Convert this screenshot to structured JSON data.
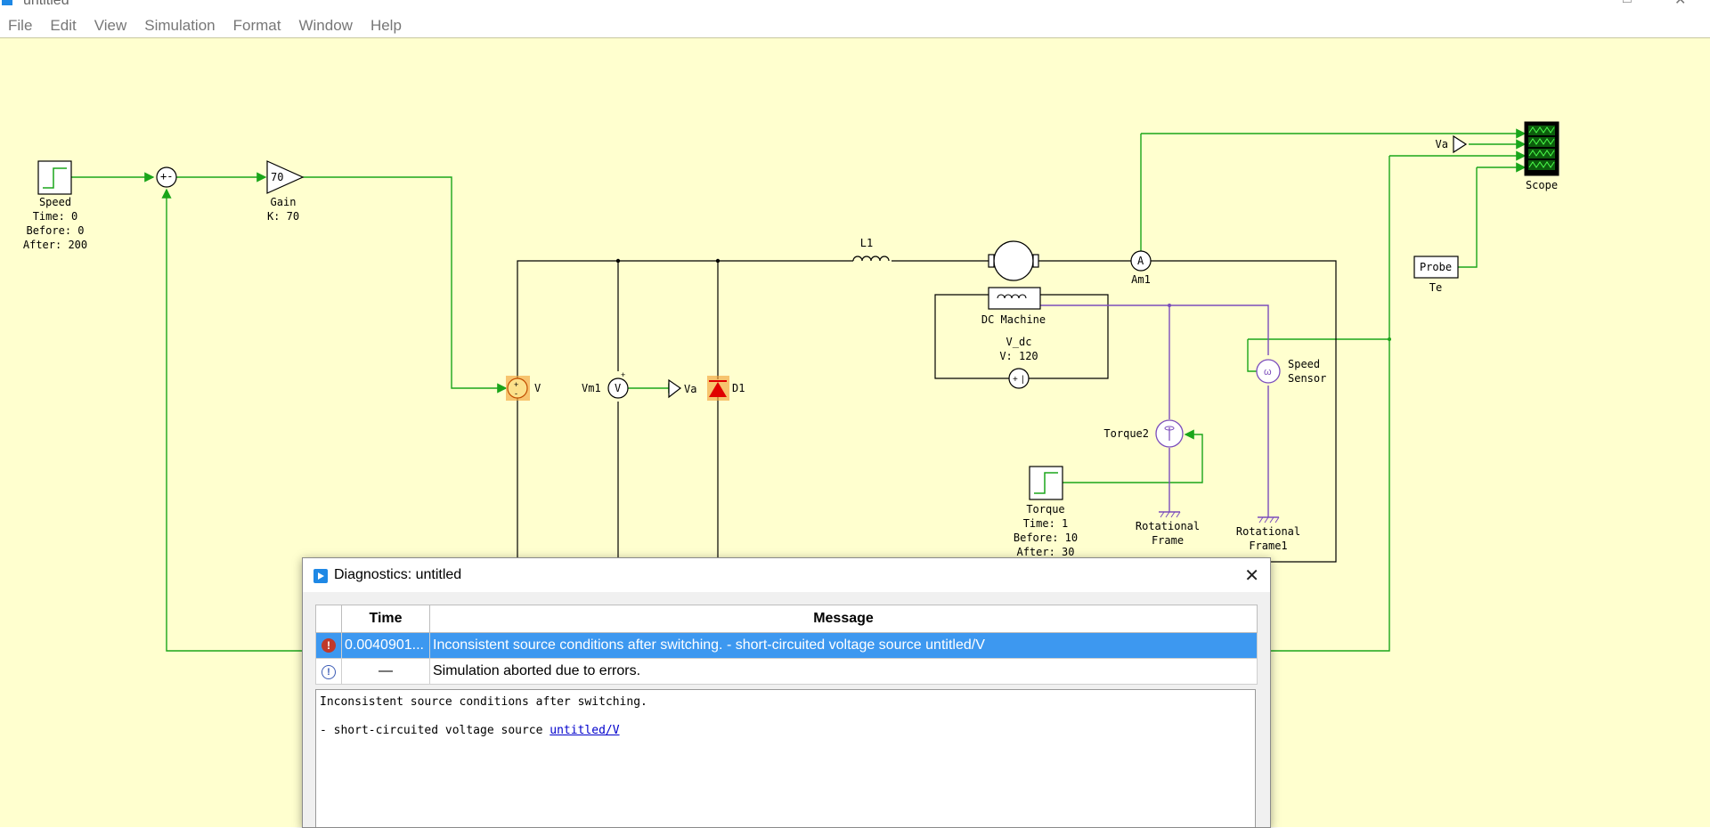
{
  "window": {
    "title": "untitled *"
  },
  "menubar": {
    "items": [
      "File",
      "Edit",
      "View",
      "Simulation",
      "Format",
      "Window",
      "Help"
    ]
  },
  "schematic": {
    "speed_step": {
      "name": "Speed",
      "params": [
        "Time: 0",
        "Before: 0",
        "After: 200"
      ]
    },
    "sum_sign": "+-",
    "gain": {
      "value": "70",
      "name": "Gain",
      "param": "K: 70"
    },
    "voltage_source": "V",
    "voltmeter": {
      "name": "Vm1",
      "symbol": "V"
    },
    "goto_va": "Va",
    "diode": "D1",
    "inductor": "L1",
    "dc_machine": "DC Machine",
    "vdc": {
      "name": "V_dc",
      "param": "V: 120"
    },
    "ammeter": {
      "name": "Am1",
      "symbol": "A"
    },
    "torque_source": "Torque2",
    "torque_step": {
      "name": "Torque",
      "params": [
        "Time: 1",
        "Before: 10",
        "After: 30"
      ]
    },
    "rot_frame": [
      "Rotational",
      "Frame"
    ],
    "rot_frame1": [
      "Rotational",
      "Frame1"
    ],
    "speed_sensor": [
      "Speed",
      "Sensor"
    ],
    "probe": {
      "label": "Probe",
      "name": "Te"
    },
    "scope": "Scope",
    "from_va": "Va"
  },
  "diagnostics": {
    "title": "Diagnostics: untitled",
    "columns": {
      "time": "Time",
      "message": "Message"
    },
    "rows": [
      {
        "type": "error",
        "time": "0.0040901...",
        "message": "Inconsistent source conditions after switching.  - short-circuited voltage source untitled/V"
      },
      {
        "type": "info",
        "time": "—",
        "message": "Simulation aborted due to errors."
      }
    ],
    "detail": {
      "line1": "Inconsistent source conditions after switching.",
      "line2_prefix": "- short-circuited voltage source ",
      "link": "untitled/V"
    }
  },
  "colors": {
    "canvas": "#ffffcf",
    "signal_wire": "#1aa51a",
    "power_wire": "#000000",
    "mech_wire": "#7b4dbc",
    "selection": "#3d98f0"
  }
}
